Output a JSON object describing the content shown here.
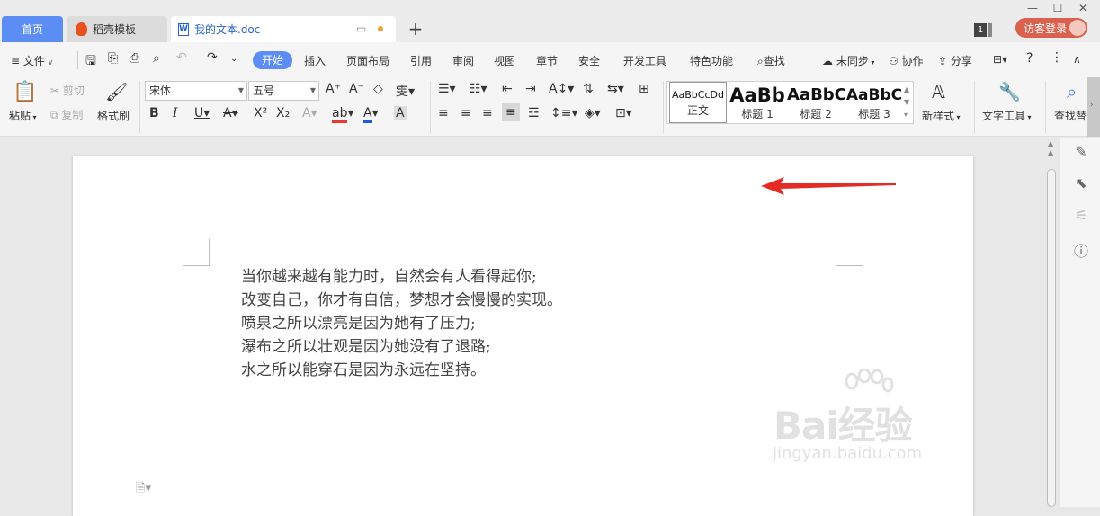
{
  "tabs": {
    "home": "首页",
    "daoke": "稻壳模板",
    "doc": "我的文本.doc"
  },
  "titlebar": {
    "page_count": "1",
    "login": "访客登录"
  },
  "menu": {
    "file": "文件",
    "start": "开始",
    "insert": "插入",
    "layout": "页面布局",
    "reference": "引用",
    "review": "审阅",
    "view": "视图",
    "chapter": "章节",
    "security": "安全",
    "devtools": "开发工具",
    "features": "特色功能",
    "search": "查找",
    "sync": "未同步",
    "collab": "协作",
    "share": "分享"
  },
  "ribbon": {
    "paste": "粘贴",
    "cut": "剪切",
    "copy": "复制",
    "format_painter": "格式刷",
    "font_name": "宋体",
    "font_size": "五号",
    "styles": [
      {
        "sample": "AaBbCcDd",
        "label": "正文"
      },
      {
        "sample": "AaBb",
        "label": "标题 1"
      },
      {
        "sample": "AaBbC",
        "label": "标题 2"
      },
      {
        "sample": "AaBbC",
        "label": "标题 3"
      }
    ],
    "new_style": "新样式",
    "text_tools": "文字工具",
    "find_replace": "查找替"
  },
  "document": {
    "lines": [
      "当你越来越有能力时，自然会有人看得起你;",
      "改变自己，你才有自信，梦想才会慢慢的实现。",
      "喷泉之所以漂亮是因为她有了压力;",
      "瀑布之所以壮观是因为她没有了退路;",
      "水之所以能穿石是因为永远在坚持。"
    ]
  },
  "watermark": {
    "logo": "Bai经验",
    "url": "jingyan.baidu.com"
  },
  "colors": {
    "accent": "#5b8df4",
    "login": "#d9614e",
    "arrow": "#e52b24"
  }
}
